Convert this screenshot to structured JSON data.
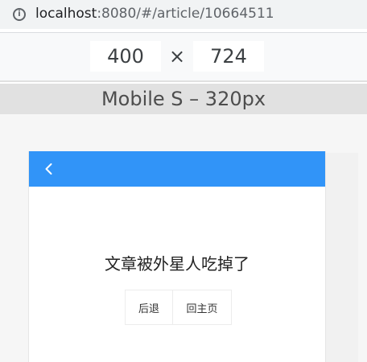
{
  "browser": {
    "url_host": "localhost",
    "url_rest": ":8080/#/article/10664511",
    "info_icon": "info-icon"
  },
  "devtools": {
    "width": "400",
    "height": "724",
    "times_sign": "×",
    "device_label": "Mobile S – 320px"
  },
  "app": {
    "nav_color": "#3194f8",
    "back_icon": "chevron-left-icon",
    "message": "文章被外星人吃掉了",
    "buttons": {
      "back_label": "后退",
      "home_label": "回主页"
    }
  }
}
